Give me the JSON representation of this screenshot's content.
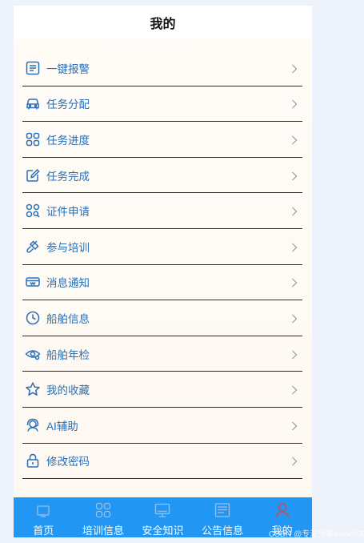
{
  "header": {
    "title": "我的"
  },
  "menu": {
    "items": [
      {
        "label": "一键报警",
        "icon": "alarm-panel-icon"
      },
      {
        "label": "任务分配",
        "icon": "car-icon"
      },
      {
        "label": "任务进度",
        "icon": "grid-icon"
      },
      {
        "label": "任务完成",
        "icon": "edit-icon"
      },
      {
        "label": "证件申请",
        "icon": "apps-search-icon"
      },
      {
        "label": "参与培训",
        "icon": "brush-icon"
      },
      {
        "label": "消息通知",
        "icon": "vr-glasses-icon"
      },
      {
        "label": "船舶信息",
        "icon": "clock-icon"
      },
      {
        "label": "船舶年检",
        "icon": "eye-icon"
      },
      {
        "label": "我的收藏",
        "icon": "star-icon"
      },
      {
        "label": "AI辅助",
        "icon": "headset-icon"
      },
      {
        "label": "修改密码",
        "icon": "lock-icon"
      }
    ]
  },
  "tabbar": {
    "tabs": [
      {
        "label": "首页",
        "icon": "home-icon",
        "active": false
      },
      {
        "label": "培训信息",
        "icon": "grid-icon",
        "active": false
      },
      {
        "label": "安全知识",
        "icon": "monitor-icon",
        "active": false
      },
      {
        "label": "公告信息",
        "icon": "news-icon",
        "active": false
      },
      {
        "label": "我的",
        "icon": "user-icon",
        "active": true
      }
    ]
  },
  "watermark": "CSDN @专注分享bishe530",
  "colors": {
    "accent": "#2a6fb8",
    "tabbar": "#2196f3",
    "active_tab_icon": "#e0453a"
  }
}
